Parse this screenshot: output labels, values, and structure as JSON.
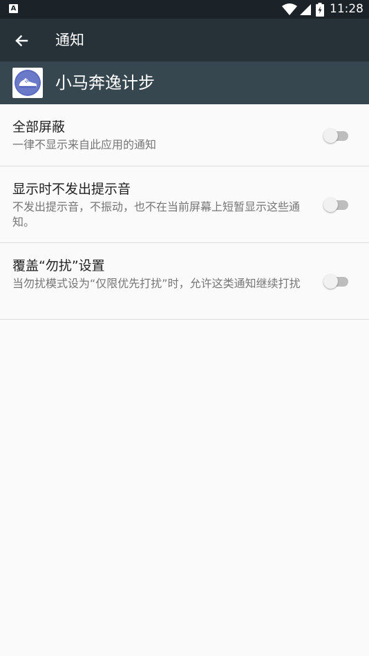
{
  "status_bar": {
    "notification_icon": "android-notification-icon",
    "time": "11:28",
    "icons": [
      "wifi-icon",
      "signal-icon",
      "battery-icon"
    ]
  },
  "toolbar": {
    "title": "通知",
    "back_icon": "back-arrow-icon"
  },
  "app": {
    "name": "小马奔逸计步",
    "icon": "shoe-icon"
  },
  "settings": [
    {
      "title": "全部屏蔽",
      "summary": "一律不显示来自此应用的通知",
      "enabled": false
    },
    {
      "title": "显示时不发出提示音",
      "summary": "不发出提示音，不振动，也不在当前屏幕上短暂显示这些通知。",
      "enabled": false
    },
    {
      "title": "覆盖“勿扰”设置",
      "summary": "当勿扰模式设为“仅限优先打扰”时，允许这类通知继续打扰",
      "enabled": false
    }
  ],
  "colors": {
    "status_bar": "#1b2328",
    "toolbar": "#263238",
    "app_header": "#37474f",
    "background": "#fafafa",
    "switch_track_off": "#bdbdbd",
    "switch_thumb_off": "#f1f1f1"
  }
}
